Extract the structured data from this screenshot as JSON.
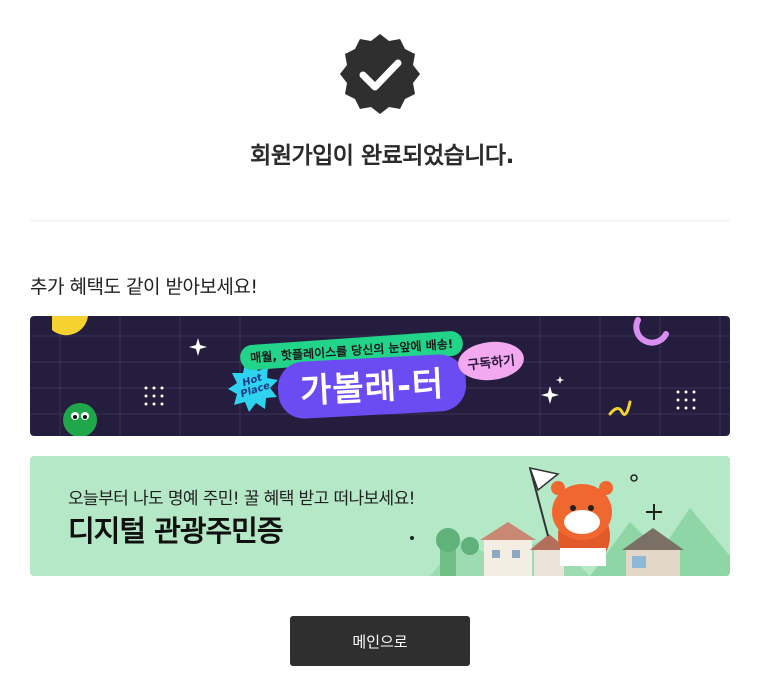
{
  "completion": {
    "icon": "verified-check-badge-icon",
    "message": "회원가입이 완료되었습니다."
  },
  "benefits": {
    "heading": "추가 혜택도 같이 받아보세요!",
    "banners": [
      {
        "tagline": "매월, 핫플레이스를 당신의 눈앞에 배송!",
        "badge": "Hot Place",
        "logo": "가볼래-터",
        "cta": "구독하기"
      },
      {
        "subtitle": "오늘부터 나도 명예 주민! 꿀 혜택 받고 떠나보세요!",
        "title": "디지털 관광주민증"
      }
    ]
  },
  "actions": {
    "main_label": "메인으로"
  },
  "colors": {
    "badge": "#2f2f2f",
    "banner1_bg": "#241d3d",
    "banner2_bg": "#b4e8c7",
    "button_bg": "#2f2f2f"
  }
}
